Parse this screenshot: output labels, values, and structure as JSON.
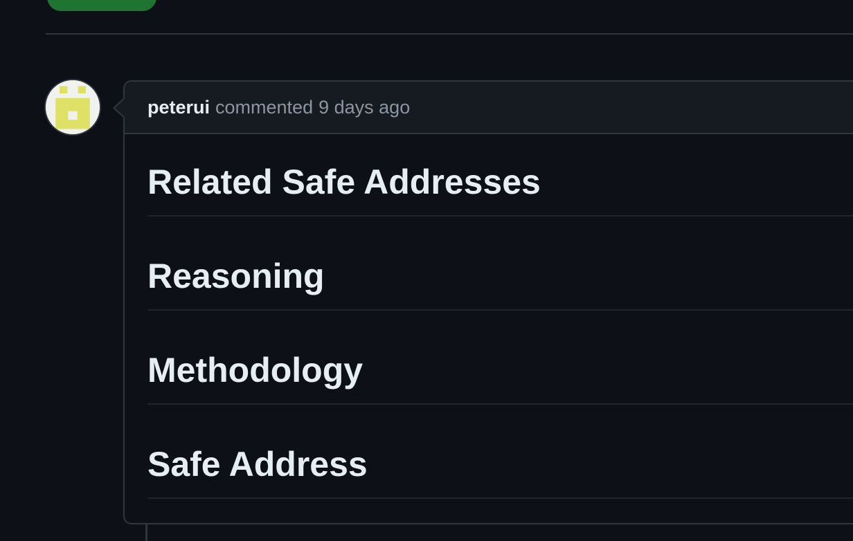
{
  "comment": {
    "author": "peterui",
    "action": "commented",
    "time": "9 days ago",
    "headings": [
      "Related Safe Addresses",
      "Reasoning",
      "Methodology",
      "Safe Address"
    ]
  },
  "colors": {
    "background": "#0d1117",
    "border": "#30363d",
    "header_bg": "#161b22",
    "button_green": "#238636",
    "avatar_accent": "#e0e060"
  },
  "icons": {
    "avatar": "identicon-avatar"
  }
}
